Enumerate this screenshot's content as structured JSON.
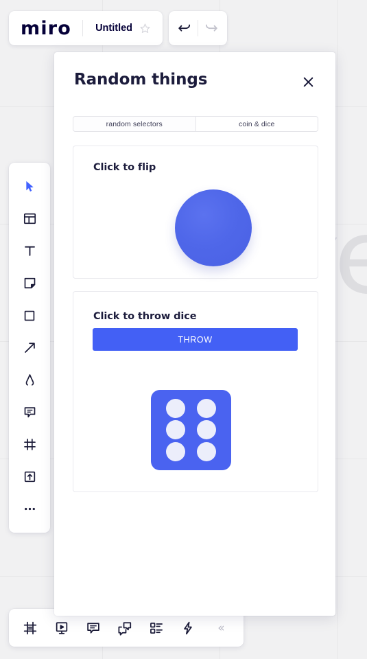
{
  "app": {
    "brand": "miro",
    "document_title": "Untitled",
    "favorite_icon": "star-outline-icon",
    "undo_icon": "undo-arrow-icon",
    "redo_icon": "redo-arrow-icon"
  },
  "left_toolbar": {
    "items": [
      {
        "name": "cursor-select-tool",
        "icon": "cursor-arrow-icon",
        "active": true
      },
      {
        "name": "templates-tool",
        "icon": "templates-grid-icon",
        "active": false
      },
      {
        "name": "text-tool",
        "icon": "text-t-icon",
        "active": false
      },
      {
        "name": "sticky-note-tool",
        "icon": "sticky-note-icon",
        "active": false
      },
      {
        "name": "shapes-tool",
        "icon": "square-shape-icon",
        "active": false
      },
      {
        "name": "connector-tool",
        "icon": "arrow-diagonal-icon",
        "active": false
      },
      {
        "name": "pen-tool",
        "icon": "pen-compass-icon",
        "active": false
      },
      {
        "name": "comment-tool",
        "icon": "comment-bubble-icon",
        "active": false
      },
      {
        "name": "frame-tool",
        "icon": "frame-icon",
        "active": false
      },
      {
        "name": "upload-tool",
        "icon": "upload-arrow-icon",
        "active": false
      },
      {
        "name": "more-tools",
        "icon": "ellipsis-icon",
        "active": false
      }
    ]
  },
  "bottom_toolbar": {
    "items": [
      {
        "name": "frames-panel-button",
        "icon": "frames-icon"
      },
      {
        "name": "presentation-button",
        "icon": "presentation-play-icon"
      },
      {
        "name": "comments-button",
        "icon": "comment-lines-icon"
      },
      {
        "name": "chat-button",
        "icon": "chat-bubbles-icon"
      },
      {
        "name": "cards-button",
        "icon": "card-list-icon"
      },
      {
        "name": "apps-button",
        "icon": "lightning-bolt-icon"
      }
    ],
    "collapse_label": "«"
  },
  "panel": {
    "title": "Random things",
    "close_icon": "close-x-icon",
    "tabs": [
      {
        "label": "random selectors",
        "selected": false
      },
      {
        "label": "coin & dice",
        "selected": true
      }
    ],
    "coin_section": {
      "title": "Click to flip",
      "coin_name": "flip-coin",
      "cursor": "pointing-hand-cursor"
    },
    "dice_section": {
      "title": "Click to throw dice",
      "throw_button_label": "THROW",
      "dice_value": 6,
      "dice_pips": [
        1,
        1,
        1,
        1,
        1,
        1
      ]
    }
  },
  "colors": {
    "accent_blue": "#4360f5",
    "coin_blue": "#4f67e9",
    "dice_blue": "#4a63f0",
    "pip_white": "#eceefb",
    "text_dark": "#1c1c3c",
    "canvas_gray": "#f1f1f2"
  }
}
